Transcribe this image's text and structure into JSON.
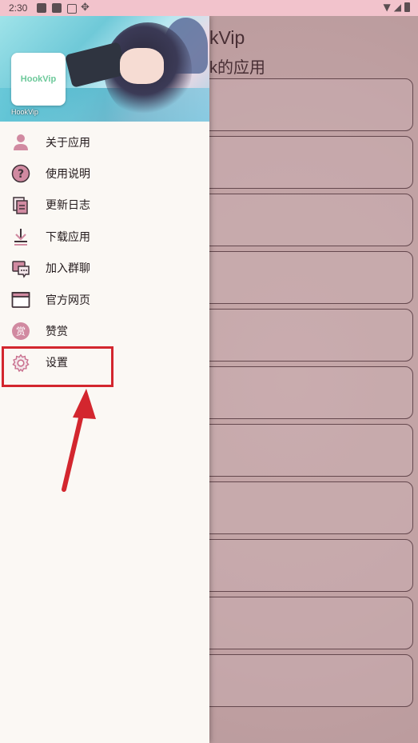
{
  "status_bar": {
    "time": "2:30"
  },
  "background_app": {
    "title": "kVip",
    "subtitle": "k的应用"
  },
  "drawer": {
    "header": {
      "logo_text": "HookVip",
      "caption": "HookVip"
    },
    "menu": [
      {
        "label": "关于应用",
        "icon": "person-icon"
      },
      {
        "label": "使用说明",
        "icon": "question-icon"
      },
      {
        "label": "更新日志",
        "icon": "log-icon"
      },
      {
        "label": "下载应用",
        "icon": "download-icon"
      },
      {
        "label": "加入群聊",
        "icon": "chat-icon"
      },
      {
        "label": "官方网页",
        "icon": "browser-icon"
      },
      {
        "label": "赞赏",
        "icon": "reward-icon",
        "icon_glyph": "赏"
      },
      {
        "label": "设置",
        "icon": "gear-icon"
      }
    ]
  },
  "annotation": {
    "highlight_color": "#d3262e"
  },
  "colors": {
    "icon": "#d18aa1",
    "icon_dark": "#403239",
    "scrim": "#784650"
  }
}
